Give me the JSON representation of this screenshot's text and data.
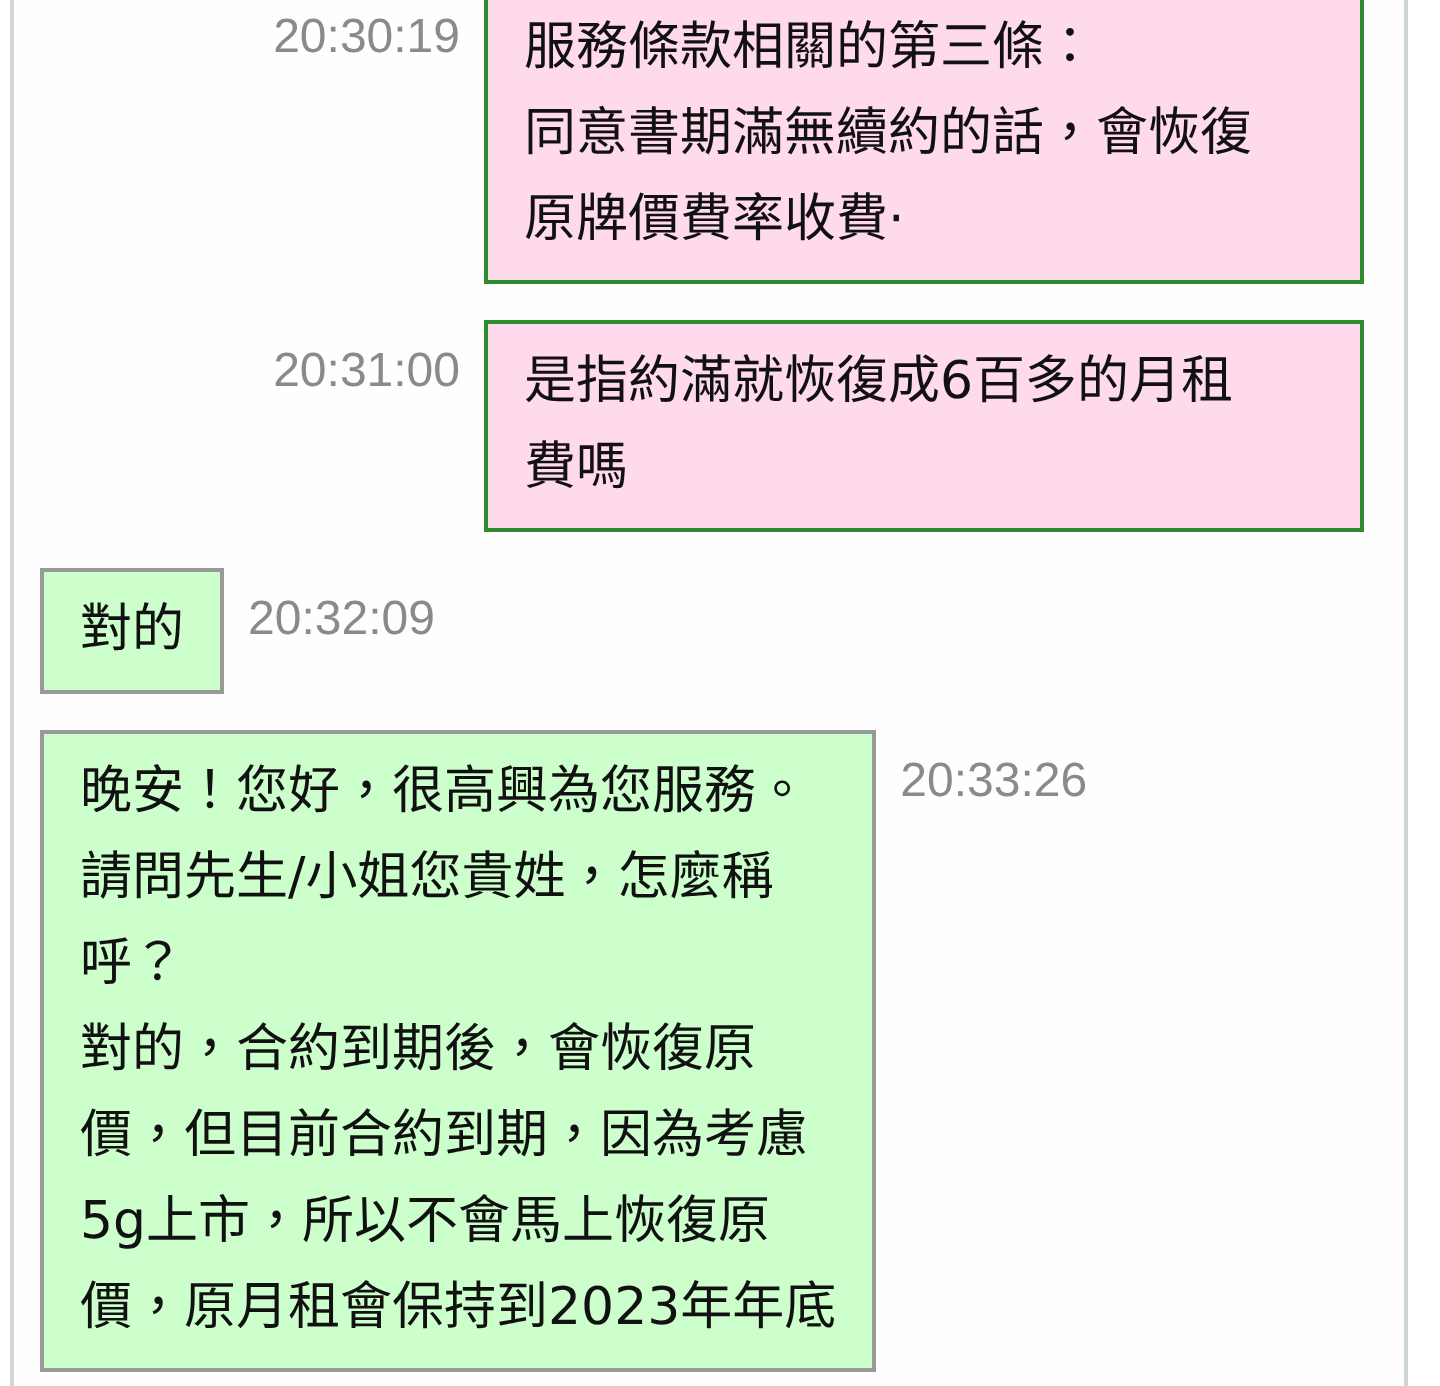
{
  "messages": [
    {
      "kind": "outgoing",
      "time": "20:30:19",
      "lines": [
        "服務條款相關的第三條：",
        "同意書期滿無續約的話，會恢復",
        "原牌價費率收費·"
      ]
    },
    {
      "kind": "outgoing",
      "time": "20:31:00",
      "lines": [
        "是指約滿就恢復成6百多的月租",
        "費嗎"
      ]
    },
    {
      "kind": "incoming",
      "time": "20:32:09",
      "lines": [
        "對的"
      ]
    },
    {
      "kind": "incoming",
      "time": "20:33:26",
      "lines": [
        "晚安！您好，很高興為您服務。",
        "請問先生/小姐您貴姓，怎麼稱",
        "呼？",
        "對的，合約到期後，會恢復原",
        "價，但目前合約到期，因為考慮",
        "5g上市，所以不會馬上恢復原",
        "價，原月租會保持到2023年年底"
      ]
    }
  ]
}
